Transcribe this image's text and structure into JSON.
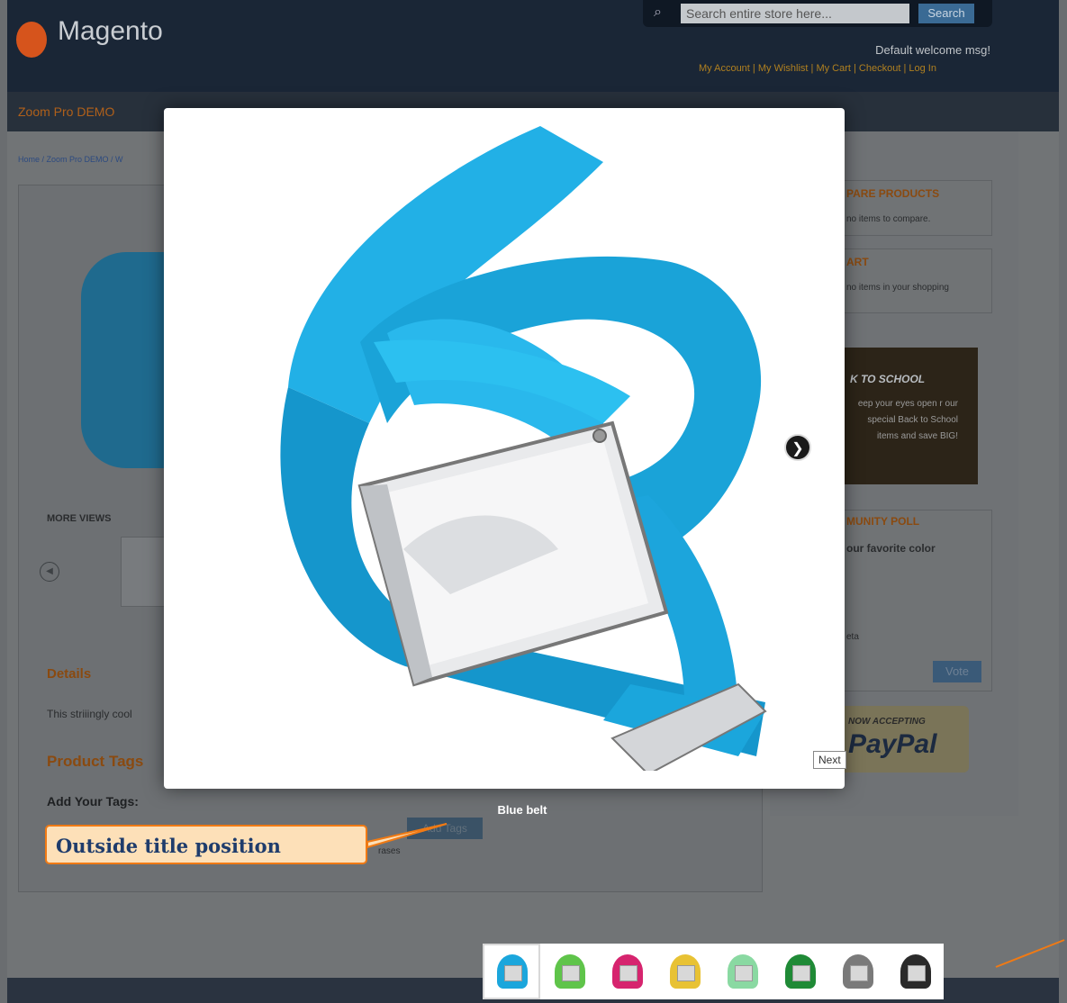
{
  "header": {
    "logo_text": "Magento",
    "search_placeholder": "Search entire store here...",
    "search_button": "Search",
    "welcome": "Default welcome msg!",
    "links": [
      "My Account",
      "My Wishlist",
      "My Cart",
      "Checkout",
      "Log In"
    ]
  },
  "nav": {
    "item": "Zoom Pro DEMO"
  },
  "breadcrumb": "Home / Zoom Pro DEMO / W",
  "product": {
    "more_views": "MORE VIEWS",
    "details_title": "Details",
    "details_text": "This striiingly cool",
    "tags_title": "Product Tags",
    "add_tags_label": "Add Your Tags:",
    "add_tags_button": "Add Tags",
    "phrase_hint": "rases"
  },
  "sidebar": {
    "compare_title": "PARE PRODUCTS",
    "compare_text": "no items to compare.",
    "cart_title": "ART",
    "cart_text": "no items in your shopping",
    "promo_title": "K TO SCHOOL",
    "promo_text": "eep your eyes open r our special Back to School items and save BIG!",
    "poll_title": "MUNITY POLL",
    "poll_question": "our favorite color",
    "poll_option": "eta",
    "vote_button": "Vote",
    "paypal_top": "NOW ACCEPTING",
    "paypal_logo": "PayPal"
  },
  "lightbox": {
    "next_label": "Next",
    "title": "Blue belt"
  },
  "callout": {
    "text": "Outside title position"
  },
  "colors": {
    "belt_blue": "#1ba6dc",
    "callout_border": "#f07a14",
    "callout_bg": "#fde0b8"
  },
  "thumbnails": [
    {
      "color": "#1ba6dc",
      "active": true
    },
    {
      "color": "#5fc44a",
      "active": false
    },
    {
      "color": "#d6246e",
      "active": false
    },
    {
      "color": "#e8c234",
      "active": false
    },
    {
      "color": "#8ad9a2",
      "active": false
    },
    {
      "color": "#1f8a36",
      "active": false
    },
    {
      "color": "#7a7a7a",
      "active": false
    },
    {
      "color": "#2a2a2a",
      "active": false
    }
  ]
}
